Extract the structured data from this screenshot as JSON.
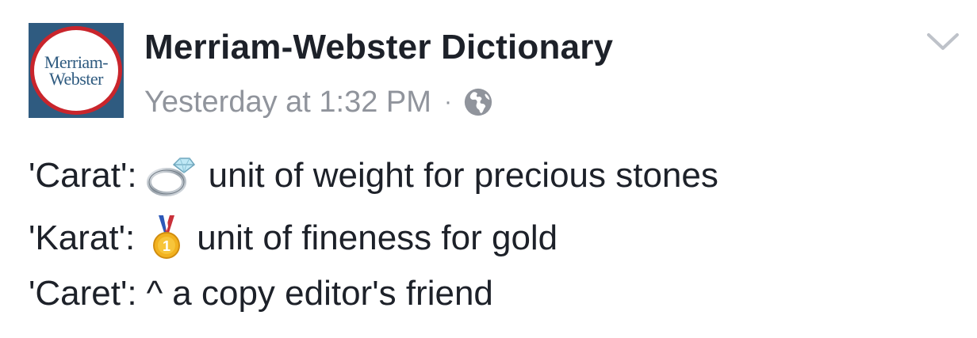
{
  "post": {
    "author": {
      "name": "Merriam-Webster Dictionary",
      "avatar": {
        "line1": "Merriam-",
        "line2": "Webster",
        "colors": {
          "background": "#2f5b80",
          "ring": "#c9252c",
          "text": "#2f5b80"
        }
      }
    },
    "timestamp": "Yesterday at 1:32 PM",
    "separator": "·",
    "audience_icon": "globe-icon",
    "menu_icon": "chevron-down-icon",
    "lines": [
      {
        "term": "'Carat':",
        "emoji": "ring-icon",
        "definition": "unit of weight for precious stones"
      },
      {
        "term": "'Karat':",
        "emoji": "medal-icon",
        "definition": "unit of fineness for gold"
      },
      {
        "term": "'Caret':",
        "symbol": "^",
        "definition": "a copy editor's friend"
      }
    ],
    "colors": {
      "text": "#1d2129",
      "secondary": "#90949c"
    }
  }
}
